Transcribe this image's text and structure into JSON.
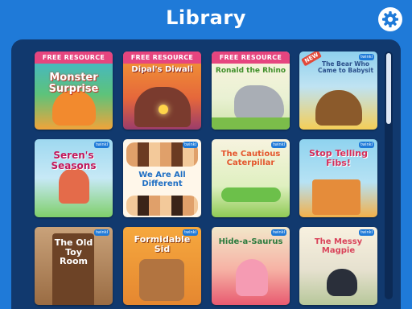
{
  "header": {
    "title": "Library"
  },
  "icons": {
    "settings": "gear-icon"
  },
  "badges": {
    "free": "FREE RESOURCE",
    "new": "NEW"
  },
  "books": [
    {
      "title": "Monster Surprise",
      "free": true
    },
    {
      "title": "Dipal's Diwali",
      "free": true
    },
    {
      "title": "Ronald the Rhino",
      "free": true
    },
    {
      "title": "The Bear Who Came to Babysit",
      "new": true
    },
    {
      "title": "Seren's Seasons"
    },
    {
      "title": "We Are All Different"
    },
    {
      "title": "The Cautious Caterpillar"
    },
    {
      "title": "Stop Telling Fibs!"
    },
    {
      "title": "The Old Toy Room"
    },
    {
      "title": "Formidable Sid"
    },
    {
      "title": "Hide-a-Saurus"
    },
    {
      "title": "The Messy Magpie"
    }
  ],
  "colors": {
    "brand_blue": "#1f7ad8",
    "panel_navy": "#11396e",
    "ribbon_pink": "#e6457f"
  }
}
